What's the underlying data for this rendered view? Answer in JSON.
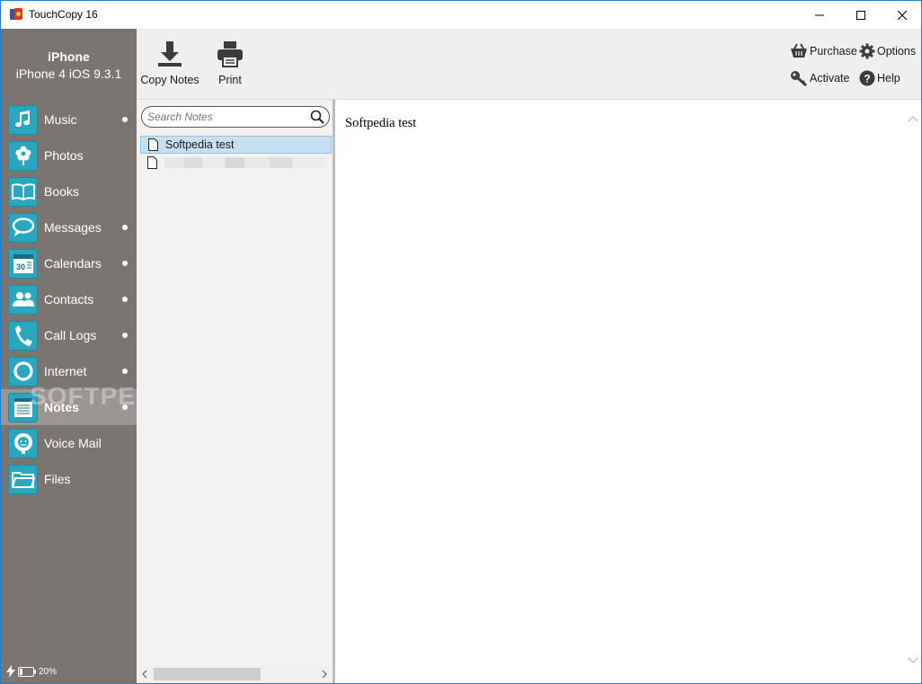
{
  "window": {
    "title": "TouchCopy 16"
  },
  "device": {
    "name": "iPhone",
    "info": "iPhone 4 iOS 9.3.1"
  },
  "toolbar": {
    "copy_label": "Copy Notes",
    "print_label": "Print",
    "purchase_label": "Purchase",
    "options_label": "Options",
    "activate_label": "Activate",
    "help_label": "Help"
  },
  "sidebar": {
    "items": [
      {
        "label": "Music",
        "icon": "music-icon",
        "dot": true
      },
      {
        "label": "Photos",
        "icon": "flower-icon",
        "dot": false
      },
      {
        "label": "Books",
        "icon": "book-icon",
        "dot": false
      },
      {
        "label": "Messages",
        "icon": "speech-bubble-icon",
        "dot": true
      },
      {
        "label": "Calendars",
        "icon": "calendar-icon",
        "dot": true
      },
      {
        "label": "Contacts",
        "icon": "contacts-icon",
        "dot": true
      },
      {
        "label": "Call Logs",
        "icon": "phone-icon",
        "dot": true
      },
      {
        "label": "Internet",
        "icon": "globe-icon",
        "dot": true
      },
      {
        "label": "Notes",
        "icon": "notepad-icon",
        "dot": true,
        "active": true
      },
      {
        "label": "Voice Mail",
        "icon": "voicemail-icon",
        "dot": false
      },
      {
        "label": "Files",
        "icon": "folder-icon",
        "dot": false
      }
    ],
    "calendar_day": "30"
  },
  "status": {
    "battery": "20%"
  },
  "notes_list": {
    "search_placeholder": "Search Notes",
    "items": [
      {
        "title": "Softpedia test",
        "selected": true
      },
      {
        "title": "",
        "selected": false,
        "obscured": true
      }
    ]
  },
  "note_content": {
    "text": "Softpedia test"
  },
  "watermark": "SOFTPEDIA"
}
